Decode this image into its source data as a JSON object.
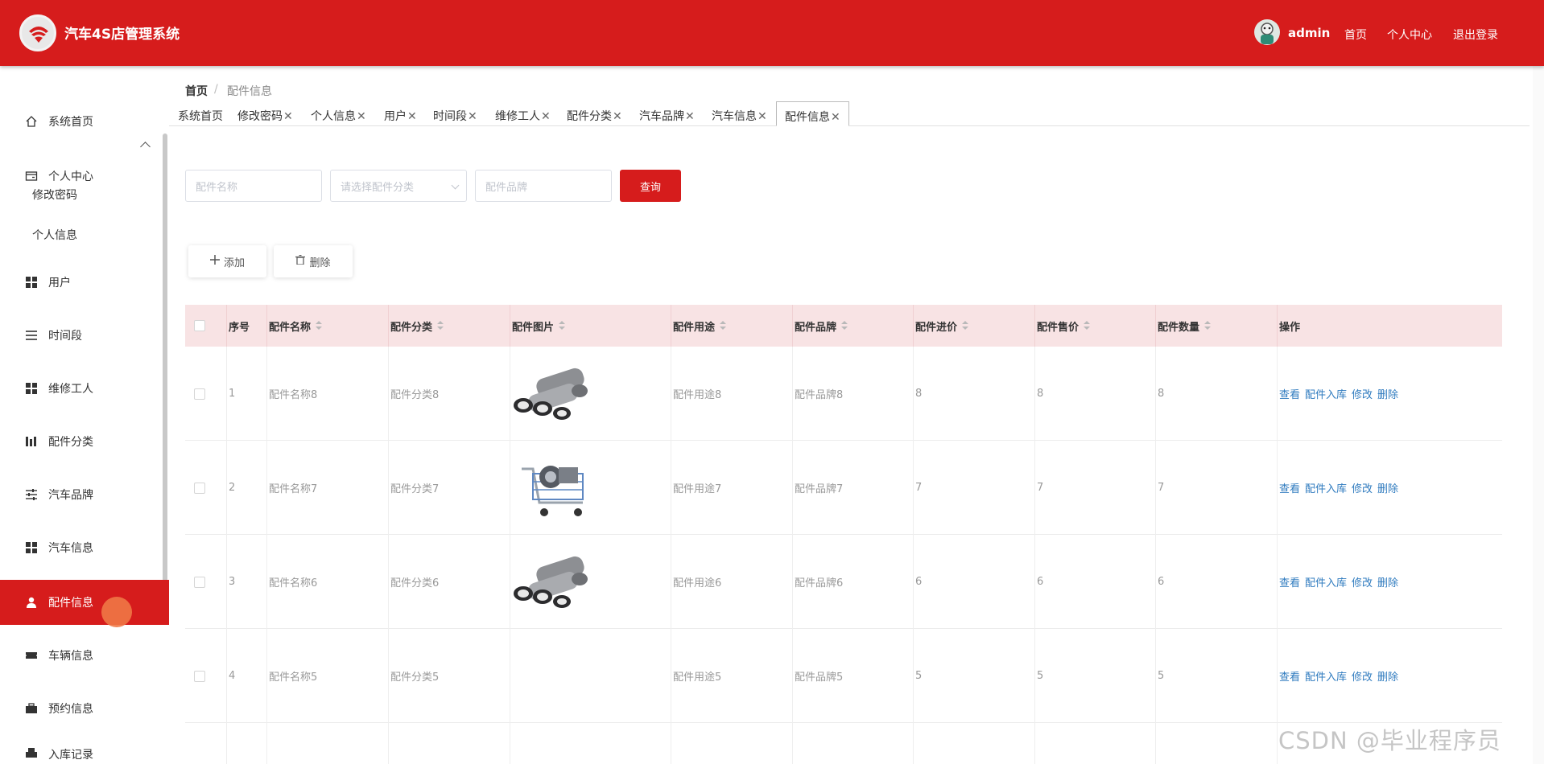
{
  "header": {
    "app_title": "汽车4S店管理系统",
    "username": "admin",
    "nav": [
      "首页",
      "个人中心",
      "退出登录"
    ]
  },
  "sidebar": {
    "items": [
      {
        "label": "系统首页",
        "icon": "home-icon"
      },
      {
        "label": "个人中心",
        "icon": "wallet-icon"
      },
      {
        "label": "用户",
        "icon": "grid-icon"
      },
      {
        "label": "时间段",
        "icon": "list-icon"
      },
      {
        "label": "维修工人",
        "icon": "grid-icon"
      },
      {
        "label": "配件分类",
        "icon": "chart-icon"
      },
      {
        "label": "汽车品牌",
        "icon": "sliders-icon"
      },
      {
        "label": "汽车信息",
        "icon": "grid-icon"
      },
      {
        "label": "配件信息",
        "icon": "user-icon"
      },
      {
        "label": "车辆信息",
        "icon": "ticket-icon"
      },
      {
        "label": "预约信息",
        "icon": "briefcase-icon"
      },
      {
        "label": "入库记录",
        "icon": "printer-icon"
      }
    ],
    "sub_items": [
      "修改密码",
      "个人信息"
    ],
    "active": "配件信息"
  },
  "breadcrumb": {
    "home": "首页",
    "sep": "/",
    "current": "配件信息"
  },
  "tabs": [
    {
      "label": "系统首页",
      "closable": false
    },
    {
      "label": "修改密码",
      "closable": true
    },
    {
      "label": "个人信息",
      "closable": true
    },
    {
      "label": "用户",
      "closable": true
    },
    {
      "label": "时间段",
      "closable": true
    },
    {
      "label": "维修工人",
      "closable": true
    },
    {
      "label": "配件分类",
      "closable": true
    },
    {
      "label": "汽车品牌",
      "closable": true
    },
    {
      "label": "汽车信息",
      "closable": true
    },
    {
      "label": "配件信息",
      "closable": true,
      "active": true
    }
  ],
  "close_glyph": "✕",
  "search": {
    "name_placeholder": "配件名称",
    "category_placeholder": "请选择配件分类",
    "brand_placeholder": "配件品牌",
    "query_label": "查询"
  },
  "actions": {
    "add_label": "添加",
    "delete_label": "删除"
  },
  "table": {
    "columns": [
      "序号",
      "配件名称",
      "配件分类",
      "配件图片",
      "配件用途",
      "配件品牌",
      "配件进价",
      "配件售价",
      "配件数量",
      "操作"
    ],
    "rows": [
      {
        "index": "1",
        "name": "配件名称8",
        "category": "配件分类8",
        "image": "exhaust-pipes",
        "usage": "配件用途8",
        "brand": "配件品牌8",
        "cost": "8",
        "price": "8",
        "qty": "8"
      },
      {
        "index": "2",
        "name": "配件名称7",
        "category": "配件分类7",
        "image": "parts-cart",
        "usage": "配件用途7",
        "brand": "配件品牌7",
        "cost": "7",
        "price": "7",
        "qty": "7"
      },
      {
        "index": "3",
        "name": "配件名称6",
        "category": "配件分类6",
        "image": "exhaust-pipes",
        "usage": "配件用途6",
        "brand": "配件品牌6",
        "cost": "6",
        "price": "6",
        "qty": "6"
      },
      {
        "index": "4",
        "name": "配件名称5",
        "category": "配件分类5",
        "image": "",
        "usage": "配件用途5",
        "brand": "配件品牌5",
        "cost": "5",
        "price": "5",
        "qty": "5"
      }
    ],
    "row_actions": [
      "查看",
      "配件入库",
      "修改",
      "删除"
    ]
  },
  "watermark": "CSDN @毕业程序员",
  "colors": {
    "primary": "#d61c1c",
    "header_row": "#f8e3e4",
    "link": "#2f7bbf"
  }
}
